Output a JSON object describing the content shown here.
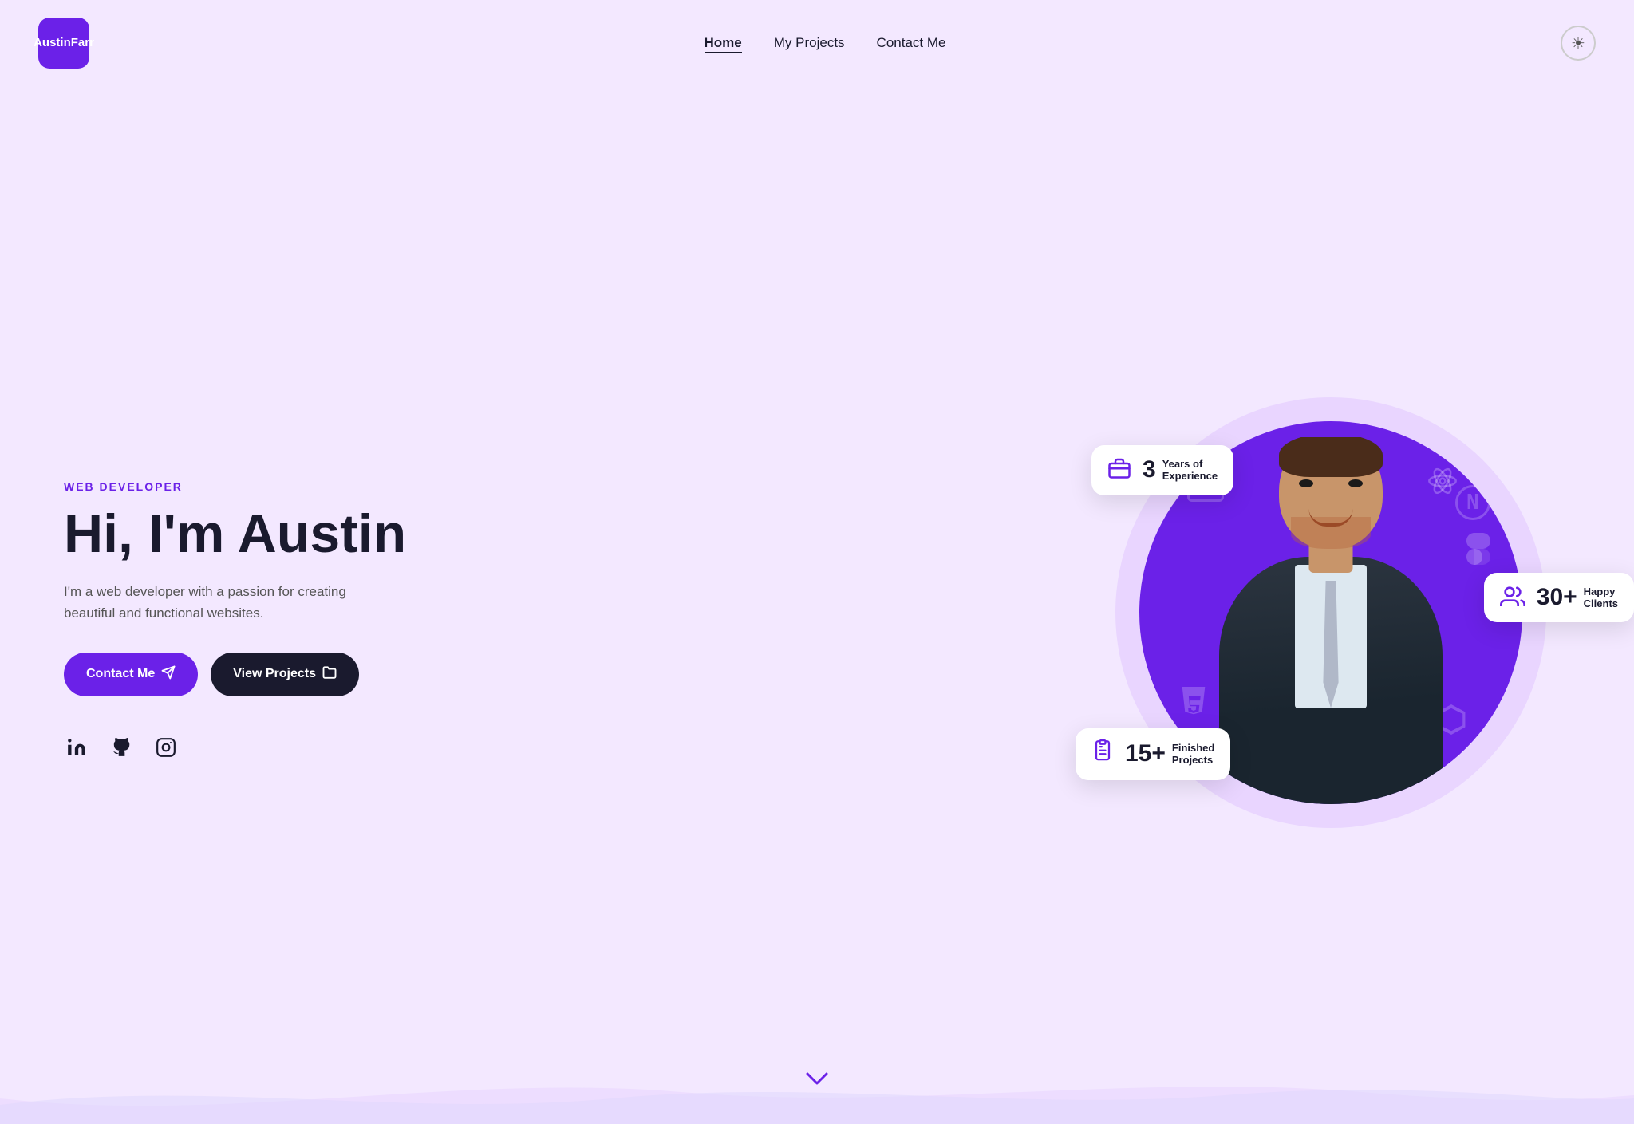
{
  "logo": {
    "line1": "Austin",
    "line2": "Farr",
    "text": "Austin\nFarr"
  },
  "nav": {
    "links": [
      {
        "label": "Home",
        "active": true
      },
      {
        "label": "My Projects",
        "active": false
      },
      {
        "label": "Contact Me",
        "active": false
      }
    ],
    "theme_toggle_icon": "☀"
  },
  "hero": {
    "subtitle": "WEB DEVELOPER",
    "title": "Hi, I'm Austin",
    "description": "I'm a web developer with a passion for creating beautiful and functional websites.",
    "btn_contact": "Contact Me",
    "btn_projects": "View Projects",
    "social": {
      "linkedin_label": "LinkedIn",
      "github_label": "GitHub",
      "instagram_label": "Instagram"
    },
    "stats": [
      {
        "id": "experience",
        "number": "3",
        "label": "Years of\nExperience",
        "icon": "💼"
      },
      {
        "id": "clients",
        "number": "30+",
        "label": "Happy\nClients",
        "icon": "👥"
      },
      {
        "id": "projects",
        "number": "15+",
        "label": "Finished\nProjects",
        "icon": "📋"
      }
    ]
  },
  "scroll_down_label": "scroll down",
  "colors": {
    "purple": "#6b21e8",
    "dark": "#1a1a2e",
    "bg": "#f3e8ff",
    "purple_light": "#d8b4fe"
  }
}
